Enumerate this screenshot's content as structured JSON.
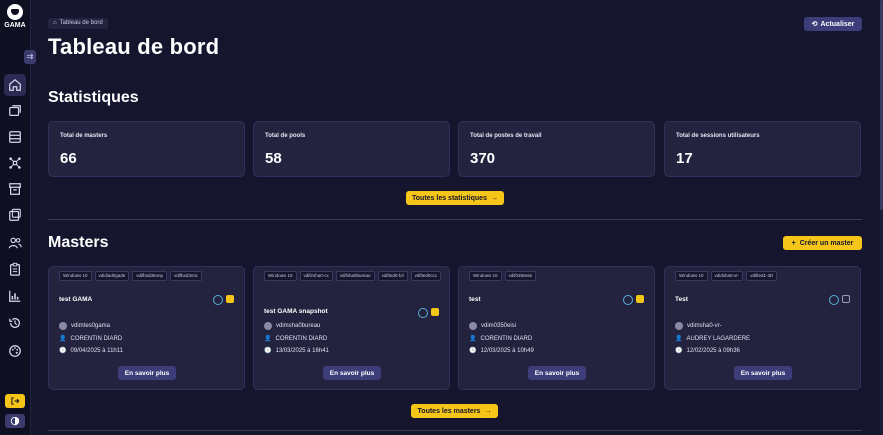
{
  "app": {
    "logo_text": "GAMA"
  },
  "sidebar": {
    "items": [
      {
        "icon": "home-icon",
        "active": true
      },
      {
        "icon": "copy-icon"
      },
      {
        "icon": "list-icon"
      },
      {
        "icon": "network-icon"
      },
      {
        "icon": "archive-icon"
      },
      {
        "icon": "windows-icon"
      },
      {
        "icon": "users-icon"
      },
      {
        "icon": "clipboard-icon"
      },
      {
        "icon": "chart-icon"
      },
      {
        "icon": "history-icon"
      },
      {
        "icon": "palette-icon"
      }
    ]
  },
  "breadcrumb": "Tableau de bord",
  "header": {
    "title": "Tableau de bord",
    "refresh_label": "Actualiser"
  },
  "stats": {
    "title": "Statistiques",
    "cards": [
      {
        "label": "Total de masters",
        "value": "66"
      },
      {
        "label": "Total de pools",
        "value": "58"
      },
      {
        "label": "Total de postes de travail",
        "value": "370"
      },
      {
        "label": "Total de sessions utilisateurs",
        "value": "17"
      }
    ],
    "all_label": "Toutes les statistiques"
  },
  "masters": {
    "title": "Masters",
    "create_label": "Créer un master",
    "all_label": "Toutes les masters",
    "more_label": "En savoir plus",
    "cards": [
      {
        "tags": [
          "Windows 10",
          "vdidiad0gade",
          "vdifbsd3temp",
          "vdifbsd3mic"
        ],
        "name": "test GAMA",
        "owner": "vdimtes0gama",
        "author": "CORENTIN DIARD",
        "date": "09/04/2025 à 11h11"
      },
      {
        "tags": [
          "Windows 10",
          "vdifirsha0-cx",
          "vdifsha0bureau",
          "vdifted0-fol",
          "vdifted0ccc"
        ],
        "name": "test GAMA snapshot",
        "owner": "vdimsha0bureau",
        "author": "CORENTIN DIARD",
        "date": "13/03/2025 à 16h41"
      },
      {
        "tags": [
          "Windows 10",
          "vdif0350eisi"
        ],
        "name": "test",
        "owner": "vdim0350eisi",
        "author": "CORENTIN DIARD",
        "date": "12/03/2025 à 10h49"
      },
      {
        "tags": [
          "Windows 10",
          "vdidsha0-vr-",
          "vdifted1-3D"
        ],
        "name": "Test",
        "owner": "vdimsha0-vr-",
        "author": "AUDREY LAGARDERE",
        "date": "12/02/2025 à 09h36"
      }
    ]
  },
  "colors": {
    "background": "#15152e",
    "card": "#23233f",
    "accent": "#f5c518",
    "button": "#3d3d7a"
  }
}
